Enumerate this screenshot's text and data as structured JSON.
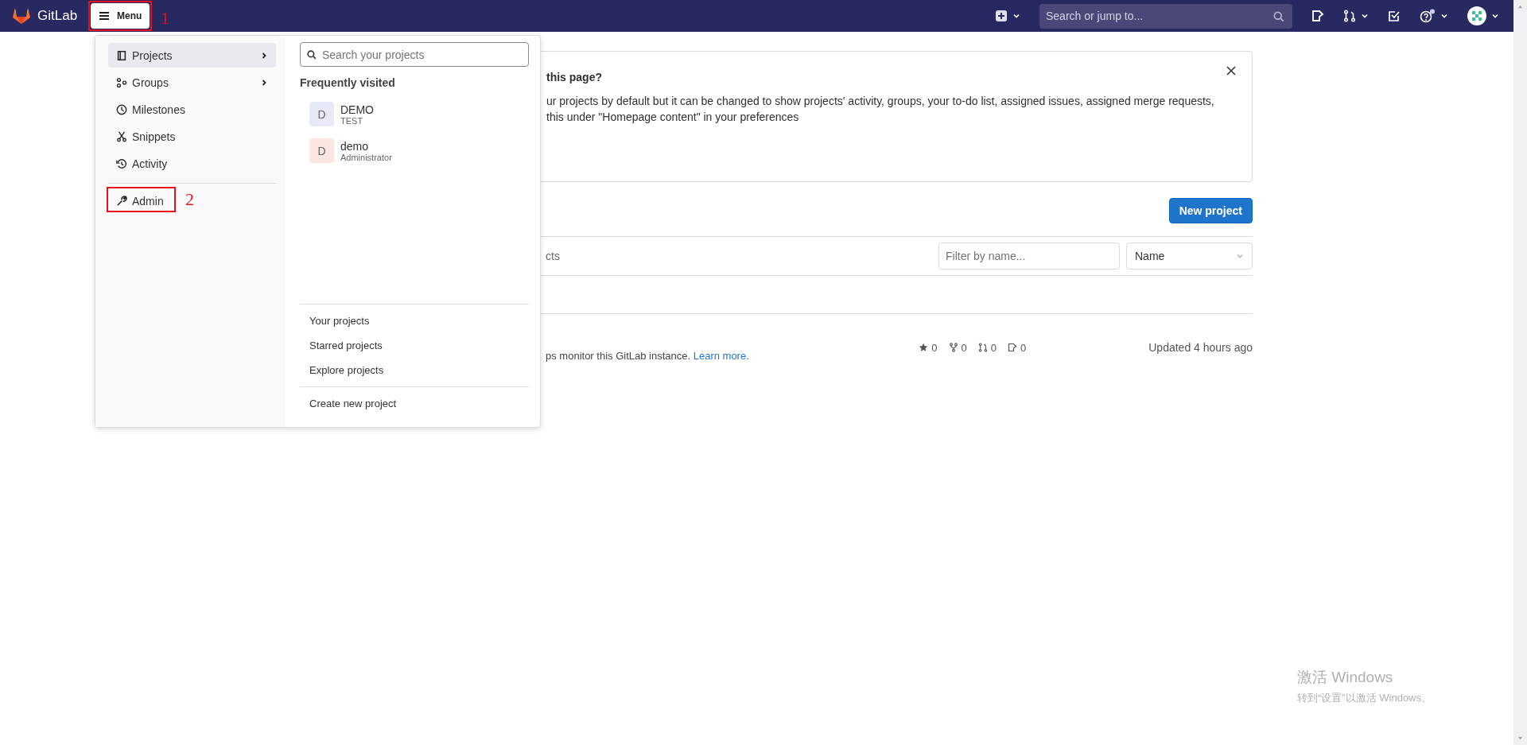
{
  "header": {
    "logo_text": "GitLab",
    "menu_button": "Menu",
    "search": {
      "placeholder": "Search or jump to..."
    }
  },
  "annotations": [
    {
      "label": "1"
    },
    {
      "label": "2"
    }
  ],
  "menu": {
    "nav": [
      {
        "kind": "projects",
        "label": "Projects",
        "selected": true,
        "submenu": true
      },
      {
        "kind": "groups",
        "label": "Groups",
        "selected": false,
        "submenu": true
      },
      {
        "kind": "milestones",
        "label": "Milestones",
        "selected": false,
        "submenu": false
      },
      {
        "kind": "snippets",
        "label": "Snippets",
        "selected": false,
        "submenu": false
      },
      {
        "kind": "activity",
        "label": "Activity",
        "selected": false,
        "submenu": false
      }
    ],
    "admin": {
      "label": "Admin"
    },
    "search": {
      "placeholder": "Search your projects"
    },
    "frequent_heading": "Frequently visited",
    "frequent": [
      {
        "initial": "D",
        "name": "DEMO",
        "namespace": "TEST",
        "color": "#e7e9f6"
      },
      {
        "initial": "D",
        "name": "demo",
        "namespace": "Administrator",
        "color": "#fbe6e2"
      }
    ],
    "links": [
      "Your projects",
      "Starred projects",
      "Explore projects"
    ],
    "create_link": "Create new project"
  },
  "alert": {
    "title": "this page?",
    "lines": [
      "ur projects by default but it can be changed to show projects' activity, groups, your to-do list, assigned issues, assigned merge requests,",
      "this under \"Homepage content\" in your preferences"
    ]
  },
  "new_project_button": "New project",
  "tab_fragment": "cts",
  "filter": {
    "placeholder": "Filter by name..."
  },
  "sort": {
    "value": "Name"
  },
  "project": {
    "description": "ps monitor this GitLab instance.",
    "link": "Learn more.",
    "stats": [
      {
        "kind": "star",
        "count": "0"
      },
      {
        "kind": "fork",
        "count": "0"
      },
      {
        "kind": "merge",
        "count": "0"
      },
      {
        "kind": "issue",
        "count": "0"
      }
    ],
    "updated": "Updated 4 hours ago"
  },
  "os_notice": {
    "title": "激活 Windows",
    "subtitle": "转到“设置”以激活 Windows。"
  }
}
